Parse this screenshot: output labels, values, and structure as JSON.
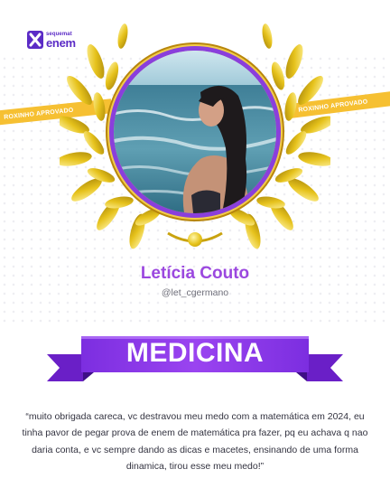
{
  "brand": {
    "small": "sequemat",
    "big": "enem"
  },
  "ribbon_text": "ROXINHO APROVADO",
  "student": {
    "name": "Letícia Couto",
    "handle": "@let_cgermano"
  },
  "course": "MEDICINA",
  "testimonial": "“muito obrigada careca, vc destravou meu medo com a matemática em 2024, eu tinha pavor de pegar prova de enem de matemática pra fazer, pq eu achava q nao daria conta, e vc sempre dando as dicas e macetes, ensinando de uma forma dinamica, tirou esse meu medo!”",
  "colors": {
    "purple": "#8a3fdc",
    "gold": "#e8c31c",
    "ribbon": "#f6c032"
  }
}
